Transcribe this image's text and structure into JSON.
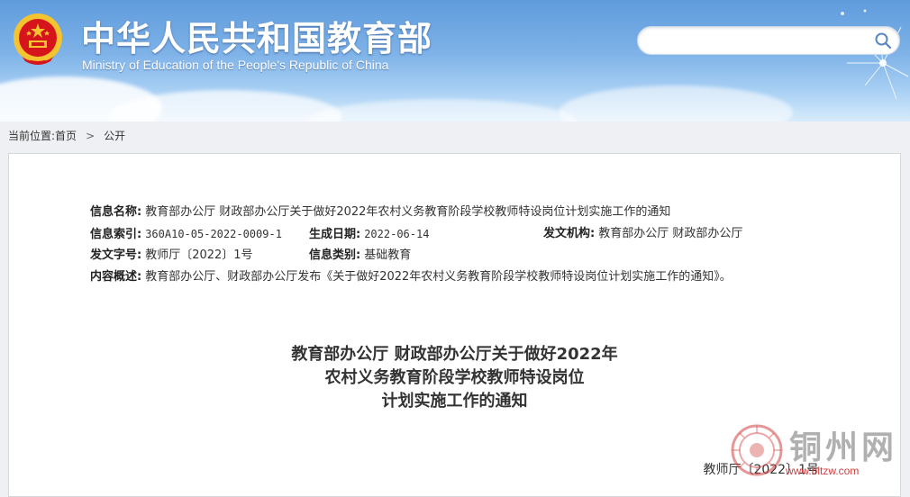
{
  "header": {
    "title_cn": "中华人民共和国教育部",
    "title_en": "Ministry of Education of the People's Republic of China",
    "search": {
      "value": "",
      "placeholder": ""
    }
  },
  "breadcrumb": {
    "prefix": "当前位置:",
    "items": [
      "首页",
      "公开"
    ],
    "separator": ">"
  },
  "info": {
    "name_label": "信息名称:",
    "name_value": "教育部办公厅 财政部办公厅关于做好2022年农村义务教育阶段学校教师特设岗位计划实施工作的通知",
    "index_label": "信息索引:",
    "index_value": "360A10-05-2022-0009-1",
    "date_label": "生成日期:",
    "date_value": "2022-06-14",
    "issuer_label": "发文机构:",
    "issuer_value": "教育部办公厅 财政部办公厅",
    "docno_label": "发文字号:",
    "docno_value": "教师厅〔2022〕1号",
    "category_label": "信息类别:",
    "category_value": "基础教育",
    "summary_label": "内容概述:",
    "summary_value": "教育部办公厅、财政部办公厅发布《关于做好2022年农村义务教育阶段学校教师特设岗位计划实施工作的通知》。"
  },
  "document": {
    "title_line1": "教育部办公厅 财政部办公厅关于做好2022年",
    "title_line2": "农村义务教育阶段学校教师特设岗位",
    "title_line3": "计划实施工作的通知",
    "number": "教师厅〔2022〕1号"
  },
  "watermark": {
    "text": "铜州网",
    "url": "www.bltzw.com"
  },
  "colors": {
    "header_top": "#5f9bdc",
    "header_bottom": "#d7ebfb",
    "emblem_red": "#d6141c",
    "emblem_gold": "#f4c430"
  },
  "icons": {
    "search": "search-icon",
    "emblem": "national-emblem-icon",
    "seal": "watermark-seal-icon"
  }
}
